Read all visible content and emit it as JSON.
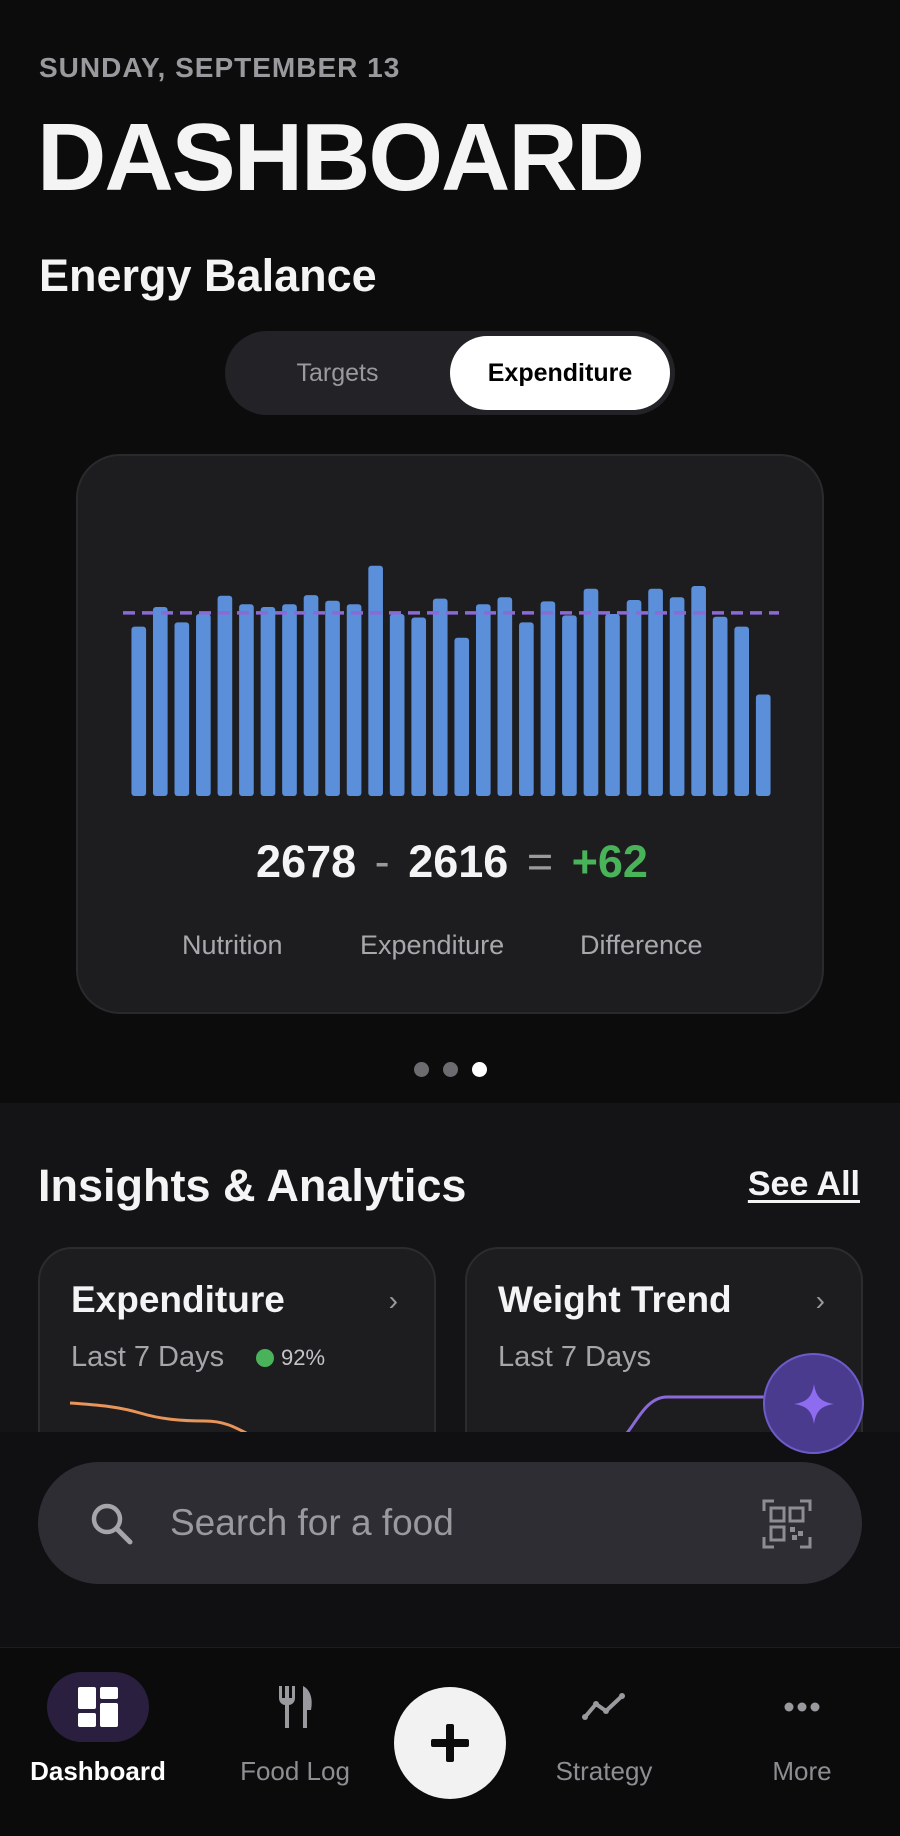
{
  "header": {
    "date": "SUNDAY, SEPTEMBER 13",
    "title": "DASHBOARD",
    "section_title": "Energy Balance"
  },
  "segmented": {
    "options": [
      "Targets",
      "Expenditure"
    ],
    "selected": "Expenditure"
  },
  "energy_card": {
    "nutrition": "2678",
    "minus": "-",
    "expenditure": "2616",
    "equals": "=",
    "difference": "+62",
    "labels": {
      "nutrition": "Nutrition",
      "expenditure": "Expenditure",
      "difference": "Difference"
    },
    "pager": {
      "count": 3,
      "active": 3
    }
  },
  "chart_data": {
    "type": "bar",
    "values": [
      2420,
      2700,
      2480,
      2600,
      2860,
      2740,
      2700,
      2740,
      2870,
      2790,
      2740,
      3290,
      2600,
      2550,
      2820,
      2260,
      2740,
      2840,
      2480,
      2780,
      2580,
      2960,
      2600,
      2800,
      2960,
      2840,
      3000,
      2560,
      2420,
      1450
    ],
    "target_line": 2616,
    "ylim": [
      0,
      3500
    ],
    "bar_color": "#5b8fd9",
    "target_color": "#8a6ad6"
  },
  "insights": {
    "title": "Insights & Analytics",
    "see_all": "See All",
    "cards": [
      {
        "title": "Expenditure",
        "subtitle": "Last 7 Days",
        "badge": "92%",
        "line_color": "#e8955a"
      },
      {
        "title": "Weight Trend",
        "subtitle": "Last 7 Days",
        "line_color": "#8a6ad6"
      }
    ],
    "chevron": "›"
  },
  "search": {
    "placeholder": "Search for a food",
    "value": ""
  },
  "tabbar": {
    "items": [
      {
        "label": "Dashboard",
        "icon": "dashboard-icon",
        "active": true
      },
      {
        "label": "Food Log",
        "icon": "fork-knife-icon",
        "active": false
      },
      {
        "label": "Strategy",
        "icon": "trend-line-icon",
        "active": false
      },
      {
        "label": "More",
        "icon": "ellipsis-icon",
        "active": false
      }
    ],
    "center_button": "plus-icon"
  },
  "colors": {
    "accent_purple": "#8a6ad6",
    "positive_green": "#49b35a",
    "background": "#0c0c0d",
    "card": "#1d1d20"
  }
}
